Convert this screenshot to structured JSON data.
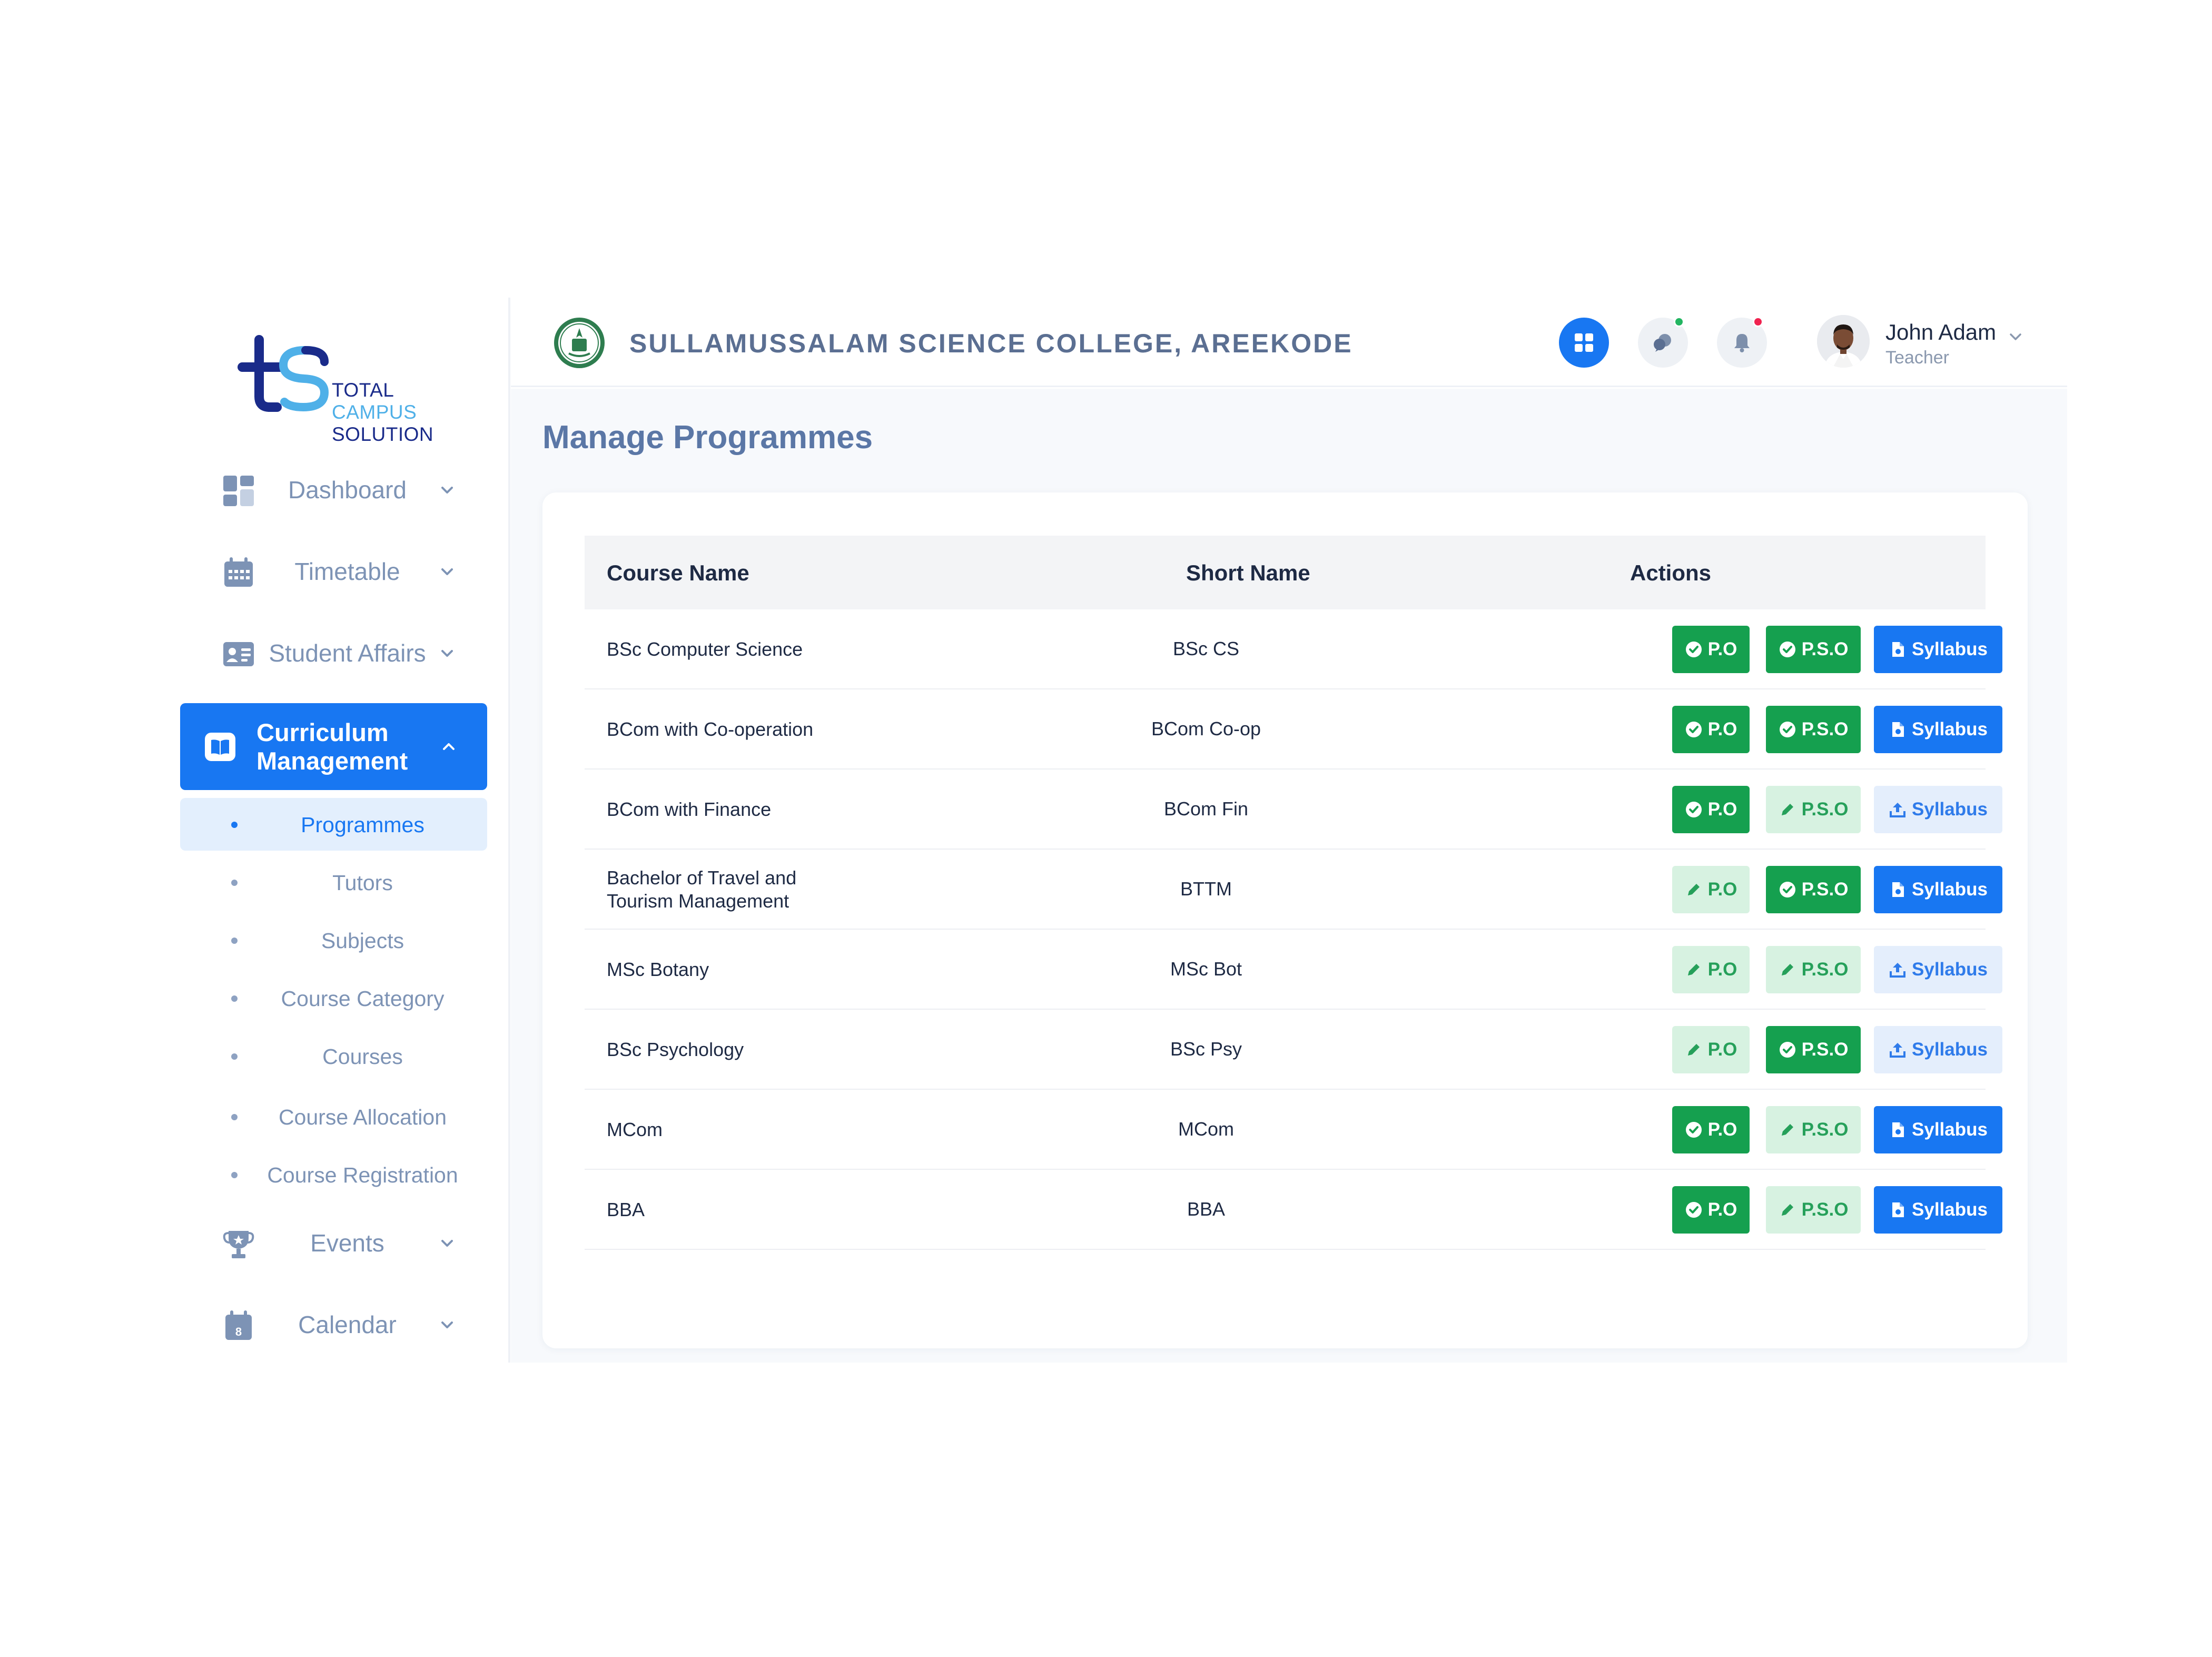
{
  "brand": {
    "line1": "TOTAL",
    "line2": "CAMPUS",
    "line3": "SOLUTION",
    "colors": {
      "primary": "#1877f2",
      "success": "#15a04f",
      "dark_blue": "#1a2b8a",
      "light_blue": "#4fb0e8"
    }
  },
  "sidebar": {
    "items": [
      {
        "label": "Dashboard",
        "icon": "dashboard-icon"
      },
      {
        "label": "Timetable",
        "icon": "calendar-grid-icon"
      },
      {
        "label": "Student Affairs",
        "icon": "id-card-icon"
      },
      {
        "label": "Curriculum Management",
        "icon": "book-icon",
        "active": true
      },
      {
        "label": "Events",
        "icon": "trophy-icon"
      },
      {
        "label": "Calendar",
        "icon": "calendar-date-icon",
        "badge": "8"
      }
    ],
    "sub_items": [
      {
        "label": "Programmes",
        "active": true
      },
      {
        "label": "Tutors"
      },
      {
        "label": "Subjects"
      },
      {
        "label": "Course Category"
      },
      {
        "label": "Courses"
      },
      {
        "label": "Course Allocation"
      },
      {
        "label": "Course Registration"
      }
    ]
  },
  "header": {
    "college_name": "SULLAMUSSALAM SCIENCE COLLEGE, AREEKODE",
    "user_name": "John Adam",
    "user_role": "Teacher"
  },
  "page": {
    "title": "Manage Programmes"
  },
  "table": {
    "columns": [
      "Course Name",
      "Short Name",
      "Actions"
    ],
    "actions": {
      "po": "P.O",
      "pso": "P.S.O",
      "syllabus": "Syllabus"
    },
    "rows": [
      {
        "name": "BSc Computer Science",
        "short": "BSc CS",
        "po": "done",
        "pso": "done",
        "syllabus": "ready"
      },
      {
        "name": "BCom with Co-operation",
        "short": "BCom Co-op",
        "po": "done",
        "pso": "done",
        "syllabus": "ready"
      },
      {
        "name": "BCom with Finance",
        "short": "BCom Fin",
        "po": "done",
        "pso": "edit",
        "syllabus": "upload"
      },
      {
        "name": "Bachelor of Travel and Tourism Management",
        "name_line1": "Bachelor of Travel and",
        "name_line2": "Tourism Management",
        "short": "BTTM",
        "po": "edit",
        "pso": "done",
        "syllabus": "ready"
      },
      {
        "name": "MSc Botany",
        "short": "MSc Bot",
        "po": "edit",
        "pso": "edit",
        "syllabus": "upload"
      },
      {
        "name": "BSc Psychology",
        "short": "BSc Psy",
        "po": "edit",
        "pso": "done",
        "syllabus": "upload"
      },
      {
        "name": "MCom",
        "short": "MCom",
        "po": "done",
        "pso": "edit",
        "syllabus": "ready"
      },
      {
        "name": "BBA",
        "short": "BBA",
        "po": "done",
        "pso": "edit",
        "syllabus": "ready"
      }
    ]
  }
}
